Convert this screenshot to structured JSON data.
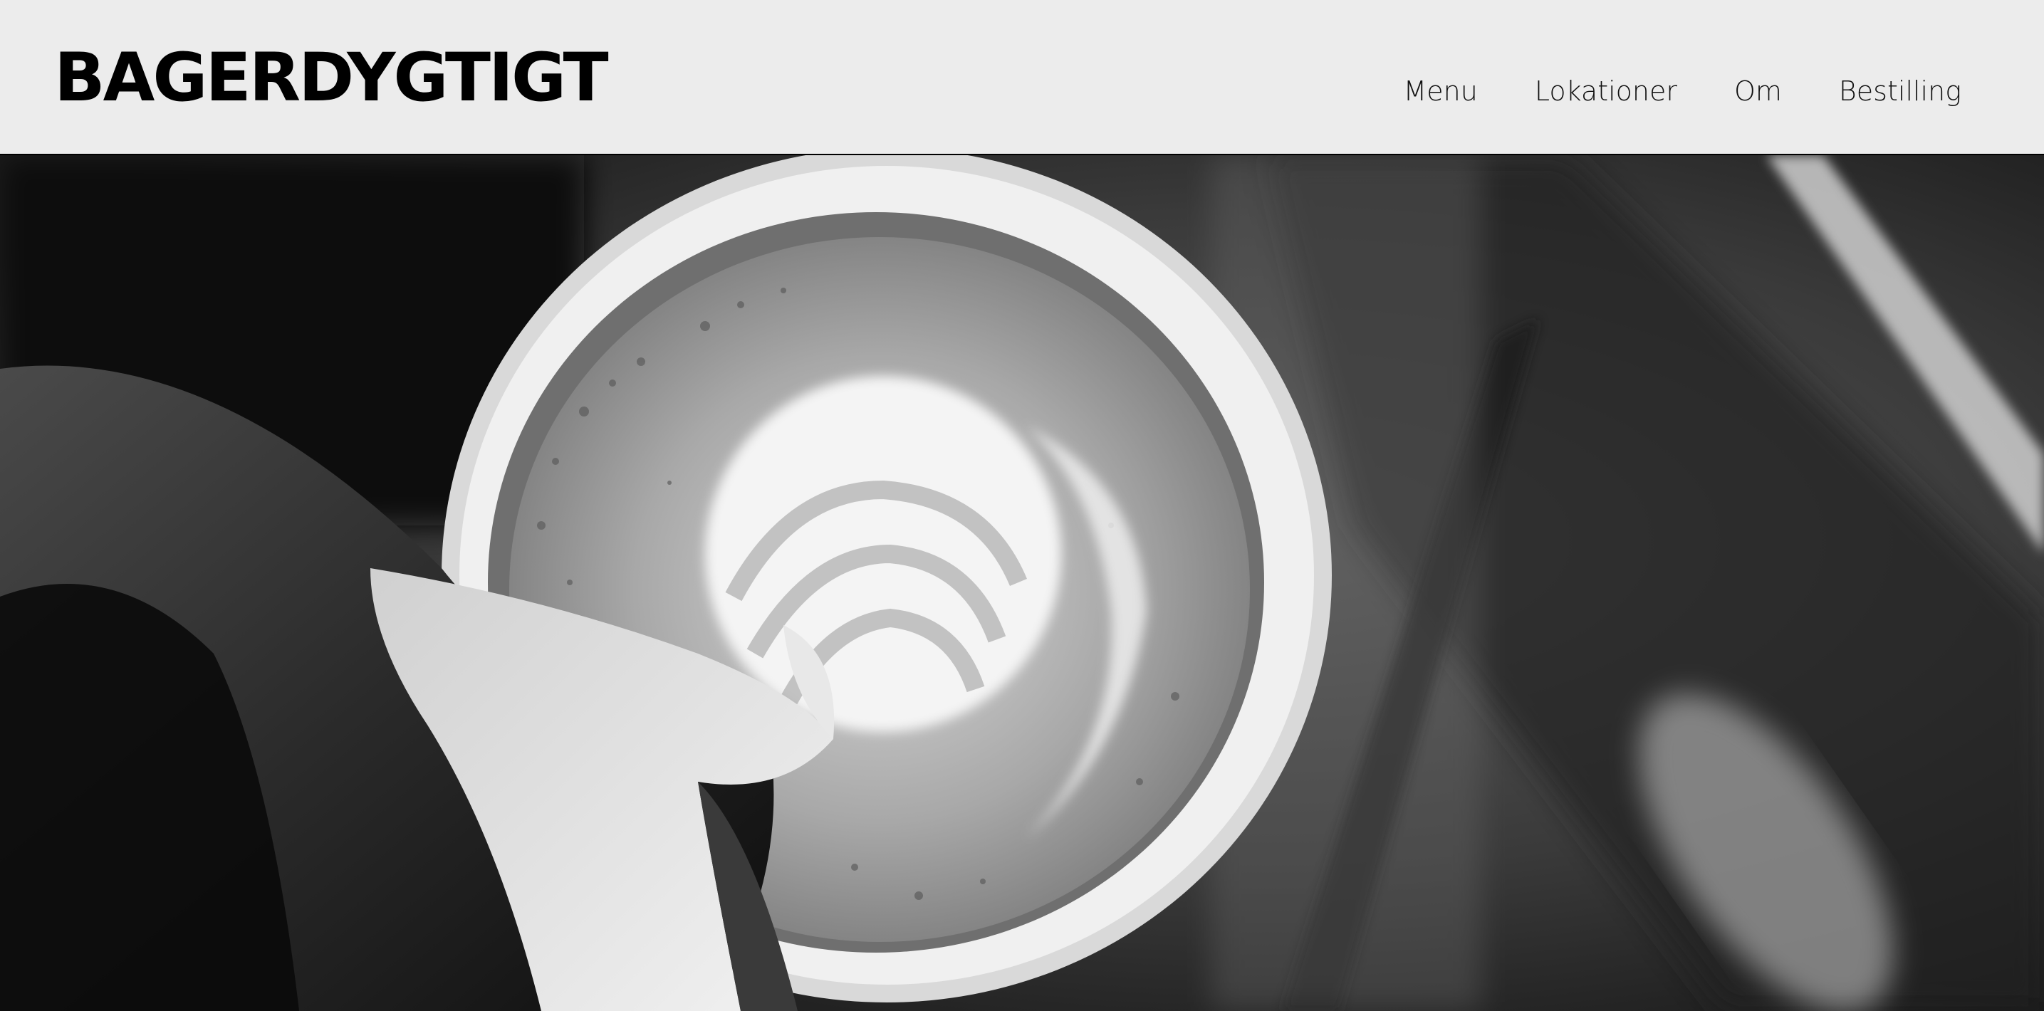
{
  "header": {
    "logo_text": "BAGERDYGTIGT",
    "nav": [
      {
        "label": "Menu"
      },
      {
        "label": "Lokationer"
      },
      {
        "label": "Om"
      },
      {
        "label": "Bestilling"
      }
    ]
  },
  "colors": {
    "header_background": "#ececec",
    "text": "#000000",
    "hero_tone": "grayscale"
  },
  "hero": {
    "image_subject": "latte-art-pour-photo"
  }
}
